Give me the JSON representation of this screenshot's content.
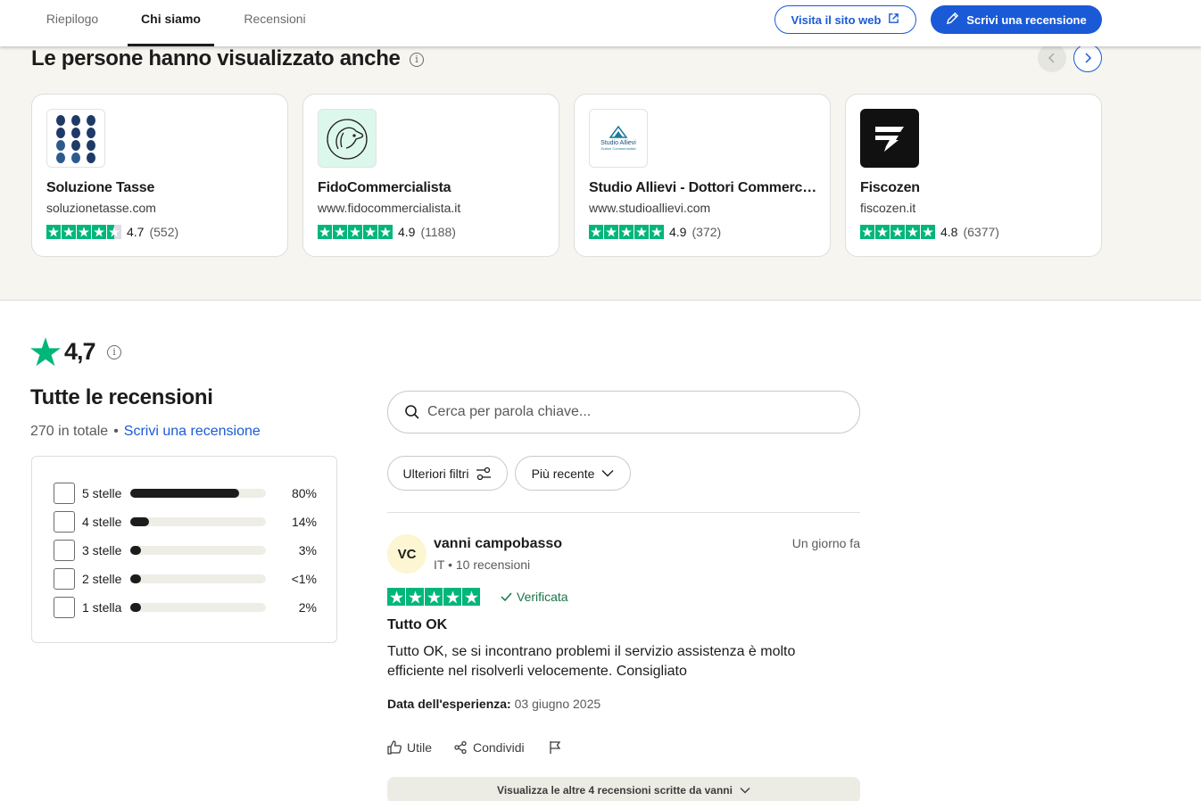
{
  "nav": {
    "tabs": [
      {
        "label": "Riepilogo"
      },
      {
        "label": "Chi siamo"
      },
      {
        "label": "Recensioni"
      }
    ],
    "visit_label": "Visita il sito web",
    "write_label": "Scrivi una recensione"
  },
  "similar": {
    "title": "Le persone hanno visualizzato anche",
    "cards": [
      {
        "name": "Soluzione Tasse",
        "url": "soluzionetasse.com",
        "rating": "4.7",
        "count": "(552)",
        "stars": 4.5
      },
      {
        "name": "FidoCommercialista",
        "url": "www.fidocommercialista.it",
        "rating": "4.9",
        "count": "(1188)",
        "stars": 5
      },
      {
        "name": "Studio Allievi - Dottori Commercialisti",
        "url": "www.studioallievi.com",
        "rating": "4.9",
        "count": "(372)",
        "stars": 5,
        "logo_text": "Studio Allievi",
        "logo_sub": "Dottori Commercialisti"
      },
      {
        "name": "Fiscozen",
        "url": "fiscozen.it",
        "rating": "4.8",
        "count": "(6377)",
        "stars": 5
      }
    ]
  },
  "summary": {
    "score": "4,7",
    "title": "Tutte le recensioni",
    "total": "270 in totale",
    "separator": "•",
    "write_link": "Scrivi una recensione",
    "distribution": [
      {
        "label": "5 stelle",
        "pct": "80%",
        "fraction": 0.8
      },
      {
        "label": "4 stelle",
        "pct": "14%",
        "fraction": 0.14
      },
      {
        "label": "3 stelle",
        "pct": "3%",
        "fraction": 0.03
      },
      {
        "label": "2 stelle",
        "pct": "<1%",
        "fraction": 0.01
      },
      {
        "label": "1 stella",
        "pct": "2%",
        "fraction": 0.02
      }
    ]
  },
  "filters": {
    "search_placeholder": "Cerca per parola chiave...",
    "more_filters": "Ulteriori filtri",
    "sort": "Più recente"
  },
  "review": {
    "initials": "VC",
    "author": "vanni campobasso",
    "meta": "IT • 10 recensioni",
    "date": "Un giorno fa",
    "stars": 5,
    "verified": "Verificata",
    "title": "Tutto OK",
    "body": "Tutto OK, se si incontrano problemi il servizio assistenza è molto efficiente nel risolverli velocemente. Consigliato",
    "experience_label": "Data dell'esperienza:",
    "experience_date": "03 giugno 2025",
    "useful": "Utile",
    "share": "Condividi",
    "more": "Visualizza le altre 4 recensioni scritte da vanni"
  },
  "colors": {
    "accent": "#1a5ad7",
    "star_green": "#00b67a",
    "section_bg": "#f6f5ef",
    "verified_green": "#1b7348"
  }
}
